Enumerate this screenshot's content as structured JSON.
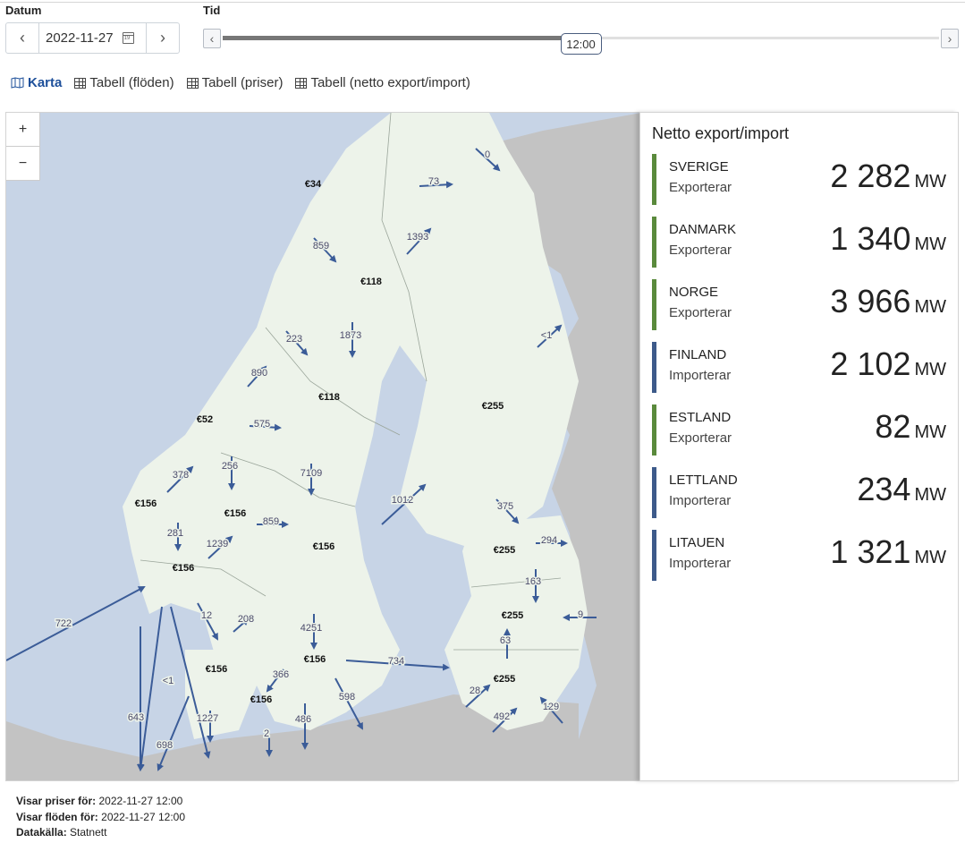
{
  "labels": {
    "datum": "Datum",
    "tid": "Tid"
  },
  "date": {
    "value": "2022-11-27",
    "prev": "‹",
    "next": "›"
  },
  "time": {
    "value": "12:00",
    "progress": 0.5
  },
  "tabs": [
    "Karta",
    "Tabell (flöden)",
    "Tabell (priser)",
    "Tabell (netto export/import)"
  ],
  "zoom": {
    "in": "+",
    "out": "−"
  },
  "colors": {
    "export": "#5a8a3c",
    "import": "#3d5a8a",
    "arrow": "#3b5c98",
    "land": "#edf3ea",
    "sea": "#c7d4e6",
    "other_land": "#c3c3c3",
    "tab_active": "#1d4f9a"
  },
  "map": {
    "prices": [
      "€34",
      "€118",
      "€118",
      "€52",
      "€156",
      "€156",
      "€156",
      "€156",
      "€156",
      "€156",
      "€156",
      "€255",
      "€255",
      "€255",
      "€255"
    ],
    "flows": [
      "0",
      "73",
      "1393",
      "859",
      "<1",
      "223",
      "1873",
      "890",
      "575",
      "378",
      "256",
      "7109",
      "281",
      "1239",
      "859",
      "1012",
      "375",
      "294",
      "163",
      "9",
      "722",
      "12",
      "208",
      "4251",
      "63",
      "734",
      "366",
      "<1",
      "598",
      "28",
      "643",
      "1227",
      "486",
      "492",
      "129",
      "698",
      "2"
    ]
  },
  "panel": {
    "title": "Netto export/import",
    "unit": "MW",
    "rows": [
      {
        "country": "SVERIGE",
        "status": "Exporterar",
        "value": "2 282",
        "type": "export"
      },
      {
        "country": "DANMARK",
        "status": "Exporterar",
        "value": "1 340",
        "type": "export"
      },
      {
        "country": "NORGE",
        "status": "Exporterar",
        "value": "3 966",
        "type": "export"
      },
      {
        "country": "FINLAND",
        "status": "Importerar",
        "value": "2 102",
        "type": "import"
      },
      {
        "country": "ESTLAND",
        "status": "Exporterar",
        "value": "82",
        "type": "export"
      },
      {
        "country": "LETTLAND",
        "status": "Importerar",
        "value": "234",
        "type": "import"
      },
      {
        "country": "LITAUEN",
        "status": "Importerar",
        "value": "1 321",
        "type": "import"
      }
    ]
  },
  "footer": {
    "prices_label": "Visar priser för:",
    "prices_value": "2022-11-27 12:00",
    "flows_label": "Visar flöden för:",
    "flows_value": "2022-11-27 12:00",
    "source_label": "Datakälla:",
    "source_value": "Statnett"
  }
}
